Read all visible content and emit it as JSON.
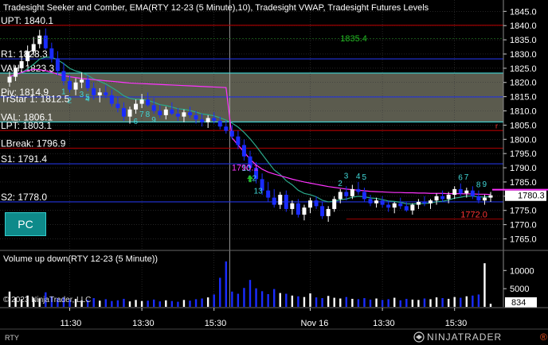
{
  "header": {
    "title": "Tradesight Seeker and Comber, EMA(RTY 12-23 (5 Minute),10), Tradesight VWAP, Tradesight Futures Levels"
  },
  "colors": {
    "background": "#000000",
    "grid": "#3a3a3a",
    "up_candle": "#ffffff",
    "down_candle": "#1a2cff",
    "ema": "#2aa88a",
    "vwap": "#ff33ff",
    "level_red": "#b00000",
    "level_blue": "#2233dd",
    "value_area_fill": "#7a7a68",
    "value_area_border": "#40d8d8",
    "seeker_text": "#40d8d8",
    "comber_text": "#22bb22",
    "volume_up": "#ffffff",
    "volume_down": "#1a2cff",
    "pc_button": "#0e8a8a",
    "last_price_marker": "#ff33ff"
  },
  "levels": [
    {
      "label": "UPT: 1840.1",
      "price": 1840.1,
      "color": "red"
    },
    {
      "label": "R1: 1828.3",
      "price": 1828.3,
      "color": "blue"
    },
    {
      "label": "VAH: 1823.3",
      "price": 1823.3,
      "color": "cyan"
    },
    {
      "label": "Piv: 1814.9",
      "price": 1814.9,
      "color": "blue"
    },
    {
      "label": "TrStar 1: 1812.5",
      "price": 1812.5,
      "color": "none"
    },
    {
      "label": "VAL: 1806.1",
      "price": 1806.1,
      "color": "cyan"
    },
    {
      "label": "LPT: 1803.1",
      "price": 1803.1,
      "color": "red"
    },
    {
      "label": "LBreak: 1796.9",
      "price": 1796.9,
      "color": "red"
    },
    {
      "label": "S1: 1791.4",
      "price": 1791.4,
      "color": "blue"
    },
    {
      "label": "S2: 1778.0",
      "price": 1778.0,
      "color": "blue"
    }
  ],
  "annotations": {
    "high_label": "1835.4",
    "low_label": "1772.0",
    "mid_label": "1790.1",
    "last_price": "1780.3",
    "volume_last": "834",
    "pc_button": "PC",
    "copyright": "© 2023 NinjaTrader, LLC",
    "symbol": "RTY",
    "brand": "NINJATRADER",
    "brand_suffix": "®"
  },
  "seeker_numbers": [
    {
      "t": "1",
      "i": 9
    },
    {
      "t": "2",
      "i": 10
    },
    {
      "t": "3",
      "i": 12
    },
    {
      "t": "4",
      "i": 13
    },
    {
      "t": "5",
      "i": 13
    },
    {
      "t": "6",
      "i": 21
    },
    {
      "t": "7",
      "i": 22
    },
    {
      "t": "8",
      "i": 23
    },
    {
      "t": "9",
      "i": 24
    },
    {
      "t": "10",
      "i": 39
    },
    {
      "t": "12",
      "i": 40
    },
    {
      "t": "13",
      "i": 41
    },
    {
      "t": "2",
      "i": 55
    },
    {
      "t": "3",
      "i": 56
    },
    {
      "t": "4",
      "i": 58
    },
    {
      "t": "5",
      "i": 59
    },
    {
      "t": "6",
      "i": 75
    },
    {
      "t": "7",
      "i": 76
    },
    {
      "t": "8",
      "i": 78
    },
    {
      "t": "9",
      "i": 79
    }
  ],
  "chart_data": {
    "type": "candlestick",
    "price_axis": {
      "ticks": [
        "1845.0",
        "1840.0",
        "1835.0",
        "1830.0",
        "1825.0",
        "1820.0",
        "1815.0",
        "1810.0",
        "1805.0",
        "1800.0",
        "1795.0",
        "1790.0",
        "1785.0",
        "1780.0",
        "1775.0",
        "1770.0",
        "1765.0"
      ],
      "ylim": [
        1761.5,
        1849.0
      ]
    },
    "time_axis": {
      "ticks": [
        "11:30",
        "13:30",
        "15:30",
        "Nov 16",
        "13:30",
        "15:30"
      ],
      "tick_bar_index": [
        10,
        22,
        34,
        50,
        62,
        74
      ]
    },
    "value_area": {
      "top": 1823.3,
      "bottom": 1806.1
    },
    "ohlc": [
      [
        1820.0,
        1824.0,
        1818.5,
        1822.0
      ],
      [
        1822.0,
        1826.0,
        1820.5,
        1825.0
      ],
      [
        1825.0,
        1829.0,
        1823.5,
        1827.5
      ],
      [
        1827.5,
        1833.0,
        1826.0,
        1831.0
      ],
      [
        1831.0,
        1836.0,
        1829.5,
        1833.5
      ],
      [
        1833.5,
        1838.5,
        1832.0,
        1836.5
      ],
      [
        1836.5,
        1839.0,
        1831.5,
        1832.0
      ],
      [
        1832.0,
        1834.0,
        1827.0,
        1828.5
      ],
      [
        1828.5,
        1831.0,
        1822.5,
        1824.0
      ],
      [
        1824.0,
        1827.0,
        1819.0,
        1820.5
      ],
      [
        1820.5,
        1822.5,
        1816.5,
        1817.5
      ],
      [
        1817.5,
        1821.5,
        1815.5,
        1820.0
      ],
      [
        1820.0,
        1823.5,
        1818.0,
        1821.0
      ],
      [
        1821.0,
        1822.5,
        1817.0,
        1818.0
      ],
      [
        1818.0,
        1820.0,
        1814.0,
        1815.5
      ],
      [
        1815.5,
        1818.0,
        1813.0,
        1816.5
      ],
      [
        1816.5,
        1819.0,
        1814.5,
        1815.5
      ],
      [
        1815.5,
        1817.5,
        1811.5,
        1812.5
      ],
      [
        1812.5,
        1815.0,
        1809.5,
        1811.0
      ],
      [
        1811.0,
        1813.0,
        1806.5,
        1808.0
      ],
      [
        1808.0,
        1811.5,
        1805.5,
        1810.5
      ],
      [
        1810.5,
        1814.0,
        1809.0,
        1812.5
      ],
      [
        1812.5,
        1816.0,
        1811.0,
        1814.0
      ],
      [
        1814.0,
        1816.5,
        1811.5,
        1812.0
      ],
      [
        1812.0,
        1814.5,
        1809.0,
        1810.0
      ],
      [
        1810.0,
        1812.0,
        1807.5,
        1808.5
      ],
      [
        1808.5,
        1811.5,
        1807.0,
        1810.5
      ],
      [
        1810.5,
        1813.0,
        1808.5,
        1809.0
      ],
      [
        1809.0,
        1811.0,
        1806.5,
        1808.0
      ],
      [
        1808.0,
        1810.5,
        1806.0,
        1809.5
      ],
      [
        1809.5,
        1811.5,
        1807.5,
        1808.5
      ],
      [
        1808.5,
        1810.0,
        1805.5,
        1807.0
      ],
      [
        1807.0,
        1809.0,
        1804.5,
        1806.0
      ],
      [
        1806.0,
        1808.5,
        1804.0,
        1807.5
      ],
      [
        1807.5,
        1809.5,
        1805.5,
        1806.5
      ],
      [
        1806.5,
        1808.0,
        1803.5,
        1804.5
      ],
      [
        1804.5,
        1806.5,
        1802.0,
        1803.0
      ],
      [
        1803.0,
        1805.0,
        1800.0,
        1801.0
      ],
      [
        1801.0,
        1803.0,
        1796.5,
        1798.0
      ],
      [
        1798.0,
        1800.0,
        1792.5,
        1794.0
      ],
      [
        1794.0,
        1796.0,
        1788.5,
        1790.0
      ],
      [
        1790.0,
        1792.0,
        1784.5,
        1786.0
      ],
      [
        1786.0,
        1788.0,
        1780.5,
        1782.0
      ],
      [
        1782.0,
        1785.0,
        1778.0,
        1779.5
      ],
      [
        1779.5,
        1782.5,
        1776.0,
        1777.0
      ],
      [
        1777.0,
        1781.5,
        1775.5,
        1780.5
      ],
      [
        1780.5,
        1782.0,
        1774.5,
        1775.5
      ],
      [
        1775.5,
        1778.5,
        1773.5,
        1777.5
      ],
      [
        1777.5,
        1779.0,
        1772.5,
        1773.5
      ],
      [
        1773.5,
        1777.0,
        1771.5,
        1776.0
      ],
      [
        1776.0,
        1779.5,
        1774.0,
        1778.5
      ],
      [
        1778.5,
        1780.0,
        1775.5,
        1776.5
      ],
      [
        1776.5,
        1778.0,
        1772.0,
        1773.0
      ],
      [
        1773.0,
        1776.5,
        1771.0,
        1775.5
      ],
      [
        1775.5,
        1780.0,
        1774.5,
        1779.0
      ],
      [
        1779.0,
        1782.5,
        1777.5,
        1781.5
      ],
      [
        1781.5,
        1783.5,
        1778.5,
        1780.0
      ],
      [
        1780.0,
        1784.0,
        1779.0,
        1782.5
      ],
      [
        1782.5,
        1785.0,
        1780.5,
        1781.5
      ],
      [
        1781.5,
        1783.0,
        1778.0,
        1779.0
      ],
      [
        1779.0,
        1780.5,
        1776.5,
        1777.5
      ],
      [
        1777.5,
        1779.5,
        1776.0,
        1778.5
      ],
      [
        1778.5,
        1780.0,
        1776.0,
        1777.0
      ],
      [
        1777.0,
        1778.5,
        1774.5,
        1776.0
      ],
      [
        1776.0,
        1778.0,
        1774.0,
        1777.5
      ],
      [
        1777.5,
        1779.5,
        1775.5,
        1776.5
      ],
      [
        1776.5,
        1778.0,
        1774.5,
        1775.0
      ],
      [
        1775.0,
        1777.5,
        1773.5,
        1777.0
      ],
      [
        1777.0,
        1779.0,
        1775.5,
        1778.0
      ],
      [
        1778.0,
        1780.0,
        1776.5,
        1777.5
      ],
      [
        1777.5,
        1779.0,
        1775.5,
        1778.5
      ],
      [
        1778.5,
        1781.0,
        1777.0,
        1780.0
      ],
      [
        1780.0,
        1782.0,
        1778.0,
        1779.0
      ],
      [
        1779.0,
        1781.5,
        1777.5,
        1780.5
      ],
      [
        1780.5,
        1783.5,
        1779.0,
        1782.5
      ],
      [
        1782.5,
        1784.5,
        1780.0,
        1781.0
      ],
      [
        1781.0,
        1783.0,
        1779.5,
        1782.0
      ],
      [
        1782.0,
        1783.5,
        1779.0,
        1780.0
      ],
      [
        1780.0,
        1782.0,
        1777.5,
        1778.5
      ],
      [
        1778.5,
        1780.5,
        1777.0,
        1779.5
      ],
      [
        1779.5,
        1781.5,
        1778.0,
        1780.3
      ]
    ],
    "vwap": [
      1822.0,
      1822.8,
      1823.5,
      1824.2,
      1824.6,
      1824.5,
      1824.1,
      1823.6,
      1822.9,
      1822.4,
      1822.0,
      1821.7,
      1821.4,
      1821.2,
      1821.0,
      1820.8,
      1820.6,
      1820.4,
      1820.2,
      1820.0,
      1819.8,
      1819.7,
      1819.6,
      1819.5,
      1819.4,
      1819.3,
      1819.2,
      1819.1,
      1819.0,
      1818.9,
      1818.8,
      1818.7,
      1818.6,
      1818.5,
      1818.4,
      1818.3,
      1818.2,
      1800.5,
      1798.0,
      1795.5,
      1793.0,
      1791.0,
      1789.5,
      1788.5,
      1787.8,
      1787.2,
      1786.6,
      1786.0,
      1785.5,
      1785.0,
      1784.6,
      1784.2,
      1783.8,
      1783.4,
      1783.1,
      1782.8,
      1782.5,
      1782.3,
      1782.1,
      1781.9,
      1781.7,
      1781.6,
      1781.5,
      1781.4,
      1781.3,
      1781.3,
      1781.2,
      1781.2,
      1781.1,
      1781.1,
      1781.0,
      1781.0,
      1781.0,
      1780.9,
      1780.9,
      1780.9,
      1780.8,
      1780.8,
      1780.7,
      1780.7,
      1780.6
    ],
    "volume": {
      "ticks": [
        "10000",
        "5000"
      ],
      "ylim": [
        0,
        14000
      ],
      "values": [
        4200,
        2600,
        2100,
        3100,
        2500,
        2300,
        4000,
        2900,
        2400,
        2600,
        2000,
        2200,
        1800,
        1900,
        2400,
        1700,
        2100,
        1600,
        1800,
        2200,
        1500,
        1900,
        1600,
        1700,
        2000,
        1500,
        1800,
        1600,
        1400,
        1900,
        1700,
        2100,
        2300,
        2600,
        3400,
        8000,
        12500,
        4200,
        3600,
        5200,
        7400,
        5100,
        4300,
        3500,
        4900,
        3800,
        3600,
        3100,
        2900,
        2700,
        3700,
        2600,
        2400,
        3000,
        2500,
        2300,
        2700,
        2200,
        2100,
        2400,
        2000,
        2300,
        1900,
        2100,
        2500,
        1800,
        2200,
        2000,
        1900,
        2300,
        2100,
        2600,
        2400,
        2200,
        2700,
        2500,
        2900,
        3100,
        3400,
        12000,
        834
      ],
      "up": [
        1,
        1,
        1,
        1,
        1,
        1,
        0,
        0,
        0,
        0,
        0,
        1,
        1,
        0,
        0,
        1,
        0,
        0,
        0,
        0,
        1,
        1,
        1,
        0,
        0,
        0,
        1,
        0,
        0,
        1,
        0,
        0,
        0,
        1,
        0,
        0,
        0,
        0,
        0,
        0,
        0,
        0,
        0,
        0,
        0,
        1,
        0,
        1,
        0,
        1,
        1,
        0,
        0,
        1,
        1,
        1,
        0,
        1,
        0,
        0,
        0,
        1,
        0,
        0,
        1,
        0,
        0,
        1,
        1,
        0,
        1,
        1,
        0,
        1,
        1,
        0,
        1,
        0,
        0,
        1,
        1
      ]
    }
  }
}
